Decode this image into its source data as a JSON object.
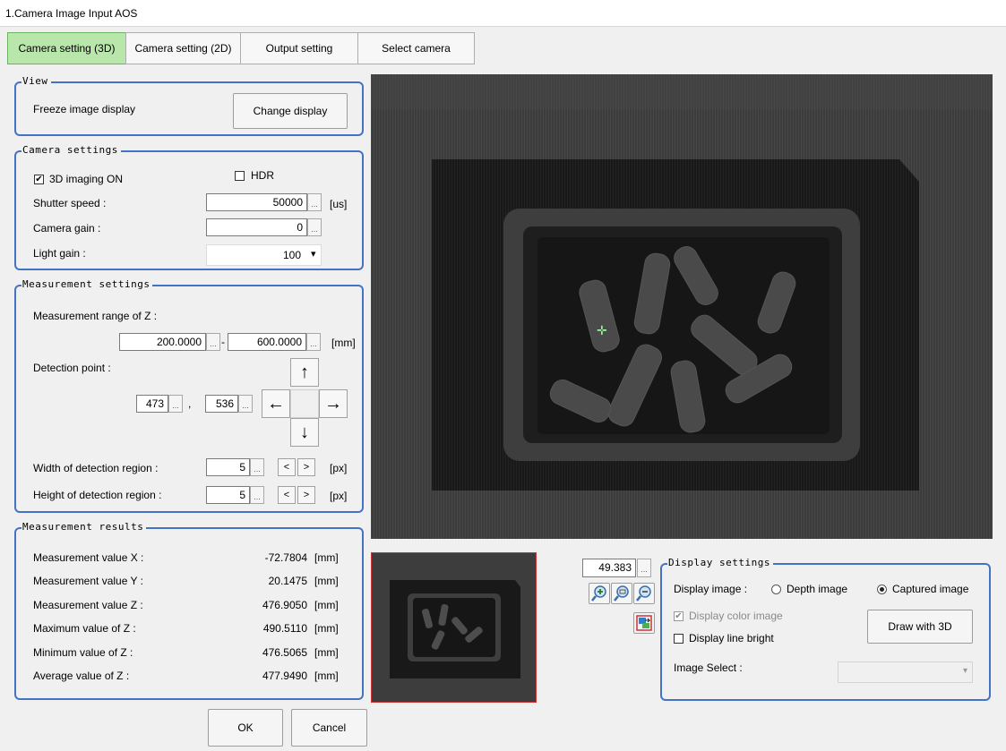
{
  "window": {
    "title": "1.Camera Image Input AOS"
  },
  "tabs": [
    {
      "label": "Camera setting (3D)",
      "active": true
    },
    {
      "label": "Camera setting (2D)"
    },
    {
      "label": "Output setting"
    },
    {
      "label": "Select camera"
    }
  ],
  "view": {
    "legend": "View",
    "freeze_label": "Freeze image display",
    "change_display_button": "Change display"
  },
  "camera_settings": {
    "legend": "Camera settings",
    "imaging_3d_label": "3D imaging ON",
    "imaging_3d_checked": true,
    "hdr_label": "HDR",
    "hdr_checked": false,
    "shutter_label": "Shutter speed :",
    "shutter_value": "50000",
    "shutter_unit": "[us]",
    "gain_label": "Camera gain :",
    "gain_value": "0",
    "light_gain_label": "Light gain :",
    "light_gain_value": "100"
  },
  "measurement_settings": {
    "legend": "Measurement settings",
    "range_label": "Measurement range of Z :",
    "range_min": "200.0000",
    "range_sep": "-",
    "range_max": "600.0000",
    "range_unit": "[mm]",
    "detection_label": "Detection point :",
    "detection_x": "473",
    "detection_comma": ",",
    "detection_y": "536",
    "width_label": "Width of detection region :",
    "width_value": "5",
    "height_label": "Height of detection region :",
    "height_value": "5",
    "px_unit": "[px]",
    "dec_symbol": "<",
    "inc_symbol": ">"
  },
  "arrows": {
    "up": "↑",
    "left": "←",
    "right": "→",
    "down": "↓"
  },
  "measurement_results": {
    "legend": "Measurement results",
    "rows": [
      {
        "label": "Measurement value X :",
        "value": "-72.7804",
        "unit": "[mm]"
      },
      {
        "label": "Measurement value Y :",
        "value": "20.1475",
        "unit": "[mm]"
      },
      {
        "label": "Measurement value Z :",
        "value": "476.9050",
        "unit": "[mm]"
      },
      {
        "label": "Maximum value of Z :",
        "value": "490.5110",
        "unit": "[mm]"
      },
      {
        "label": "Minimum value of Z :",
        "value": "476.5065",
        "unit": "[mm]"
      },
      {
        "label": "Average value of Z :",
        "value": "477.9490",
        "unit": "[mm]"
      }
    ]
  },
  "zoom": {
    "value": "49.383"
  },
  "display_settings": {
    "legend": "Display settings",
    "display_image_label": "Display image :",
    "depth_image_label": "Depth image",
    "captured_image_label": "Captured image",
    "selected": "captured",
    "color_image_label": "Display color image",
    "color_image_checked": true,
    "color_image_disabled": true,
    "line_bright_label": "Display line bright",
    "line_bright_checked": false,
    "draw3d_button": "Draw with 3D",
    "image_select_label": "Image Select :",
    "image_select_value": ""
  },
  "footer": {
    "ok_button": "OK",
    "cancel_button": "Cancel"
  },
  "ellipsis": "...",
  "check_mark": "✔",
  "dropdown_arrow": "▾",
  "colors": {
    "accent_border": "#4473c4",
    "active_tab": "#b9e6ab",
    "thumbnail_border": "#cc3333"
  }
}
